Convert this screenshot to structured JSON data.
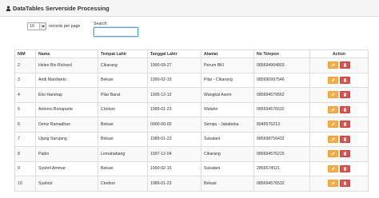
{
  "panel": {
    "title": "DataTables Serverside Processing"
  },
  "length": {
    "value": "10",
    "label": "records per page"
  },
  "search": {
    "label": "Search:",
    "value": ""
  },
  "table": {
    "headers": [
      "NIM",
      "Nama",
      "Tempat Lahir",
      "Tanggal Lahir",
      "Alamat",
      "No Telepon",
      "Action"
    ],
    "rows": [
      [
        "2",
        "Heleo Bio Richard",
        "Cikarang",
        "1990-09-27",
        "Perum BKI",
        "085694964803"
      ],
      [
        "3",
        "Andi Mardianto",
        "Bekasi",
        "1990-02-15",
        "Pilar - Cikarang",
        "085690997546"
      ],
      [
        "4",
        "Eko Harshap",
        "Pilar Barat",
        "1995-12-12",
        "Wangkal Asem",
        "085694579562"
      ],
      [
        "5",
        "Antonio Bonaparte",
        "Cirebon",
        "1989-01-23",
        "Walahir",
        "085694576532"
      ],
      [
        "6",
        "Deniz Ramadhan",
        "Bekasi",
        "0000-00-00",
        "Sempu - Jababeka",
        "8946576213"
      ],
      [
        "7",
        "Ujang Sarujang",
        "Bekasi",
        "1989-01-23",
        "Sukatani",
        "085698756432"
      ],
      [
        "8",
        "Pablo",
        "Lemahabang",
        "1997-12-04",
        "Cikarang",
        "085694576215"
      ],
      [
        "9",
        "Syahril Ammar",
        "Bekasi",
        "1990-02-15",
        "Sukatani",
        "2856574521"
      ],
      [
        "10",
        "Syahrul",
        "Cirebon",
        "1989-01-23",
        "Bekasi",
        "085694576532"
      ]
    ]
  },
  "icons": {
    "header": "user-icon",
    "edit": "pencil-icon",
    "delete": "trash-icon"
  },
  "colors": {
    "edit": "#f0ad4e",
    "delete": "#d9534f",
    "focus": "#66afe9"
  }
}
